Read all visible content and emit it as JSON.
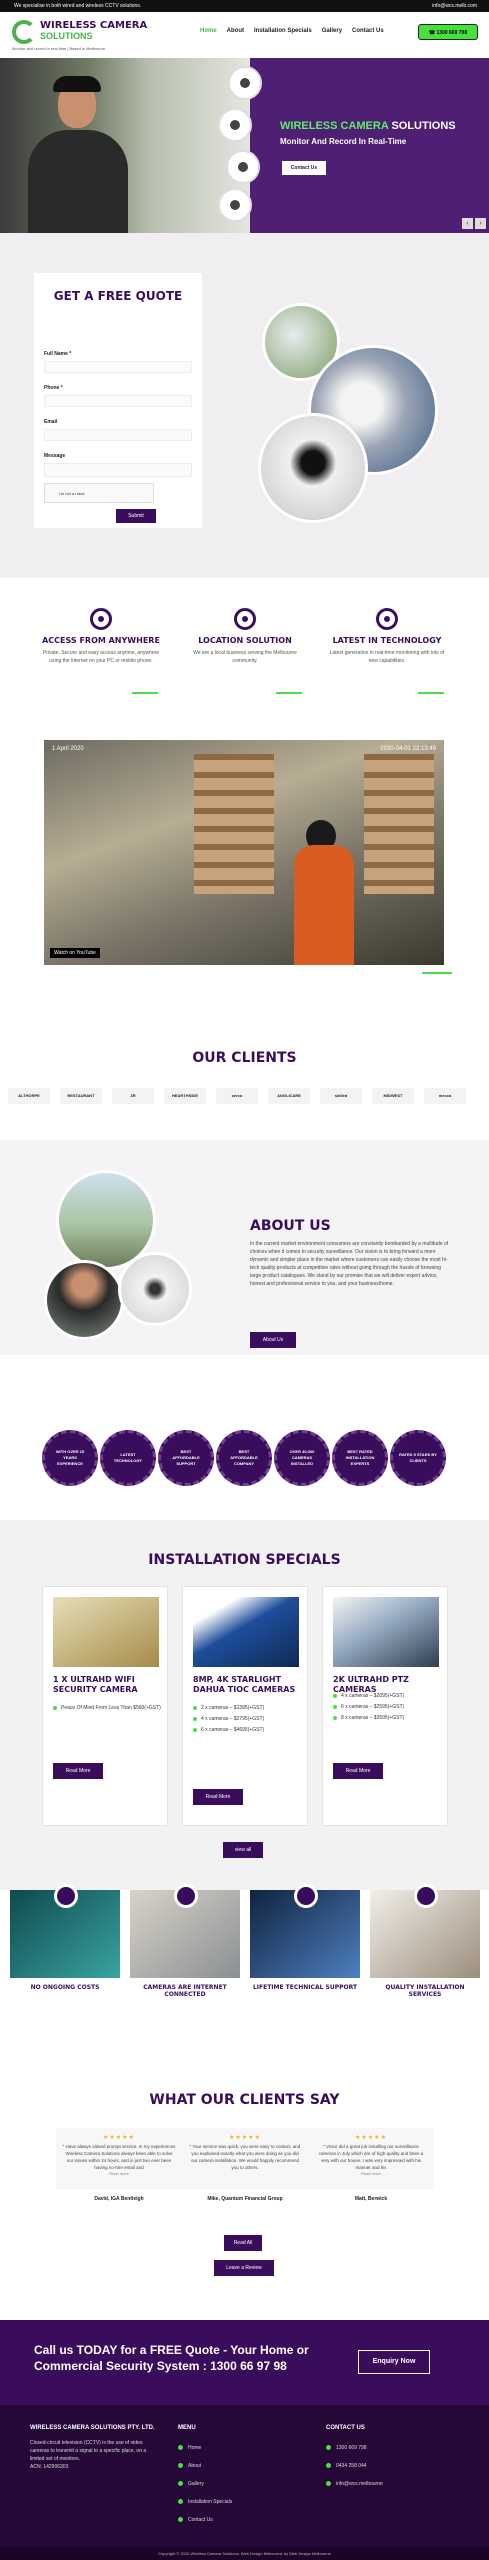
{
  "topbar": {
    "left": "We specialise in both wired and wireless CCTV solutions.",
    "right": "info@wcs.melb.com"
  },
  "header": {
    "logo_line1": "WIRELESS CAMERA",
    "logo_line2": "SOLUTIONS",
    "logo_tagline": "Monitor and record in real time | Based in Melbourne",
    "nav": [
      "Home",
      "About",
      "Installation Specials",
      "Gallery",
      "Contact Us"
    ],
    "phone": "1300 669 798"
  },
  "hero": {
    "title_green": "WIRELESS CAMERA",
    "title_white": "SOLUTIONS",
    "subtitle": "Monitor And Record In Real-Time",
    "button": "Contact Us",
    "prev": "‹",
    "next": "›"
  },
  "quote": {
    "title": "GET A FREE QUOTE",
    "labels": [
      "Full Name *",
      "Phone *",
      "Email",
      "Message"
    ],
    "captcha": "I'm not a robot",
    "submit": "Submit"
  },
  "features": [
    {
      "title": "ACCESS FROM ANYWHERE",
      "text": "Private, Secure and easy access anytime, anywhere using the internet on your PC or mobile phone."
    },
    {
      "title": "LOCATION SOLUTION",
      "text": "We are a local business serving the Melbourne community."
    },
    {
      "title": "LATEST IN TECHNOLOGY",
      "text": "Latest generation in real-time monitoring with lots of new capabilities."
    }
  ],
  "video": {
    "title": "1 April 2020",
    "watch": "Watch on YouTube",
    "timestamp": "2020-04-01 22:13:49"
  },
  "clients": {
    "title": "OUR CLIENTS",
    "logos": [
      "ALTHORPE",
      "RESTAURANT",
      "ZR",
      "HEARTHSIDE",
      "serco",
      "ANGLICARE",
      "skilled",
      "MIDWEST",
      "mecca"
    ]
  },
  "about": {
    "title": "ABOUT US",
    "text": "In the current market environment consumers are constantly bombarded by a multitude of choices when it comes to security surveillance. Our vision is to bring forward a more dynamic and simpler place in the market where customers can easily choose the most hi-tech quality products at competitive rates without going through the hassle of browsing large product catalogues. We stand by our promise that we will deliver expert advice, honest and professional service to you, and your business/home.",
    "button": "About Us"
  },
  "badges": [
    "WITH OVER 15 YEARS EXPERIENCE",
    "LATEST TECHNOLOGY",
    "BEST AFFORDABLE SUPPORT",
    "BEST AFFORDABLE COMPANY",
    "OVER 40,000 CAMERAS INSTALLED",
    "BEST RATED INSTALLATION EXPERTS",
    "RATED 5 STARS BY CLIENTS"
  ],
  "specials": {
    "title": "INSTALLATION SPECIALS",
    "cards": [
      {
        "title": "1 X ULTRAHD WIFI SECURITY CAMERA",
        "items": [
          "Peace Of Mind From Less Than $560(+GST)"
        ],
        "button": "Read More"
      },
      {
        "title": "8MP, 4K STARLIGHT DAHUA TIOC CAMERAS",
        "items": [
          "2 x cameras – $1395(+GST)",
          "4 x cameras – $2795(+GST)",
          "6 x cameras – $4695(+GST)"
        ],
        "button": "Read More"
      },
      {
        "title": "2K ULTRAHD PTZ CAMERAS",
        "items": [
          "4 x cameras – $2095(+GST)",
          "6 x cameras – $2595(+GST)",
          "8 x cameras – $3595(+GST)"
        ],
        "button": "Read More"
      }
    ],
    "view_all": "view all"
  },
  "services": [
    "NO ONGOING COSTS",
    "CAMERAS ARE INTERNET CONNECTED",
    "LIFETIME TECHNICAL SUPPORT",
    "QUALITY INSTALLATION SERVICES"
  ],
  "testimonials": {
    "title": "WHAT OUR CLIENTS SAY",
    "items": [
      {
        "stars": "★★★★★",
        "text": "\" Have always valued prompt service. In my experiences Wireless Camera Solutions always been able to solve our issues within 24 hours, and in just two ever been having no-hire email and",
        "more": "Read more",
        "name": "David, IGA Bentleigh"
      },
      {
        "stars": "★★★★★",
        "text": "\" Your service was quick, you were easy to contact, and you explained exactly what you were doing as you did our camera installation. We would happily recommend you to others.",
        "more": "",
        "name": "Mike, Quantum Financial Group"
      },
      {
        "stars": "★★★★★",
        "text": "\" Victor did a great job installing our surveillance cameras in July which are of high quality and been a very with our house. I was very impressed with his manner and his",
        "more": "Read more",
        "name": "Matt, Berwick"
      }
    ],
    "read_all": "Read All",
    "leave": "Leave a Review"
  },
  "cta": {
    "text": "Call us TODAY for a FREE Quote - Your Home or Commercial Security System : 1300 66 97 98",
    "button": "Enquiry Now"
  },
  "footer": {
    "company_title": "WIRELESS CAMERA SOLUTIONS PTY. LTD.",
    "company_text": "Closed-circuit television (CCTV) is the use of video cameras to transmit a signal to a specific place, on a limited set of monitors.",
    "acn": "ACN: 142906303",
    "menu_title": "MENU",
    "menu": [
      "Home",
      "About",
      "Gallery",
      "Installation Specials",
      "Contact Us"
    ],
    "contact_title": "CONTACT US",
    "contacts": [
      "1300 669 798",
      "0434 258 044",
      "info@wcs.melbourne"
    ],
    "copyright": "Copyright © 2020 Wireless Camera Solutions. Web Design Melbourne by Web Design Melbourne"
  },
  "colors": {
    "brand_purple": "#3a0d5c",
    "accent_green": "#46e13d"
  }
}
